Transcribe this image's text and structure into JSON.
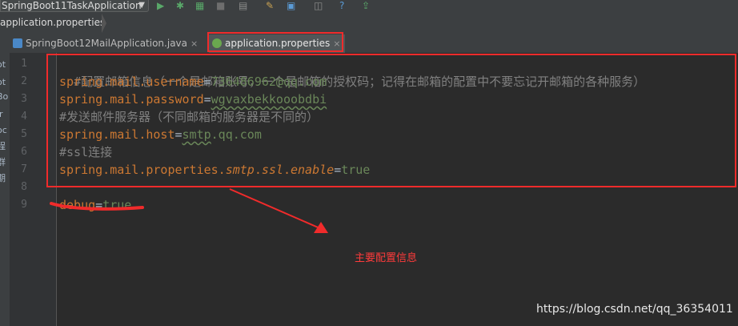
{
  "toolbar": {
    "run_configuration": "SpringBoot11TaskApplication",
    "icons": [
      "dropdown-arrow-icon",
      "run-icon",
      "debug-icon",
      "coverage-icon",
      "stop-icon",
      "build-icon",
      "settings-icon",
      "project-structure-icon",
      "sdk-icon",
      "help-icon",
      "update-icon"
    ]
  },
  "breadcrumb": {
    "item": "application.properties"
  },
  "left_panel": {
    "fragments": [
      "ot",
      "ot",
      "Bo",
      "ir",
      "oc",
      "程",
      "群",
      "期"
    ]
  },
  "tabs": [
    {
      "label": "SpringBoot12MailApplication.java",
      "icon": "java-class-icon",
      "active": false
    },
    {
      "label": "application.properties",
      "icon": "spring-properties-icon",
      "active": true
    }
  ],
  "editor": {
    "line_numbers": [
      "1",
      "2",
      "3",
      "4",
      "5",
      "6",
      "7",
      "8",
      "9"
    ],
    "lines": [
      {
        "comment": "#配置邮箱信息（一个是邮箱账号，一个是邮箱的授权码；记得在邮箱的配置中不要忘记开邮箱的各种服务）"
      },
      {
        "key": "spring.mail.username",
        "eq": "=",
        "value": "736486962@qq.com"
      },
      {
        "key": "spring.mail.password",
        "eq": "=",
        "value": "wgvaxbekkooobdbi"
      },
      {
        "comment": "#发送邮件服务器（不同邮箱的服务器是不同的）"
      },
      {
        "key": "spring.mail.host",
        "eq": "=",
        "value": "smtp",
        "value_rest": ".qq.com"
      },
      {
        "comment": "#ssl连接"
      },
      {
        "key_a": "spring.mail.properties.",
        "key_b": "smtp",
        "key_c": ".",
        "key_d": "ssl",
        "key_e": ".",
        "key_f": "enable",
        "eq": "=",
        "value": "true"
      },
      {
        "text": ""
      },
      {
        "key": "debug",
        "eq": "=",
        "value": "true"
      }
    ]
  },
  "annotation": {
    "text": "主要配置信息"
  },
  "watermark": {
    "text": "https://blog.csdn.net/qq_36354011"
  },
  "colors": {
    "highlight_red": "#f02b2b",
    "keyword": "#cc7832",
    "value": "#6a8759",
    "comment": "#808080"
  }
}
